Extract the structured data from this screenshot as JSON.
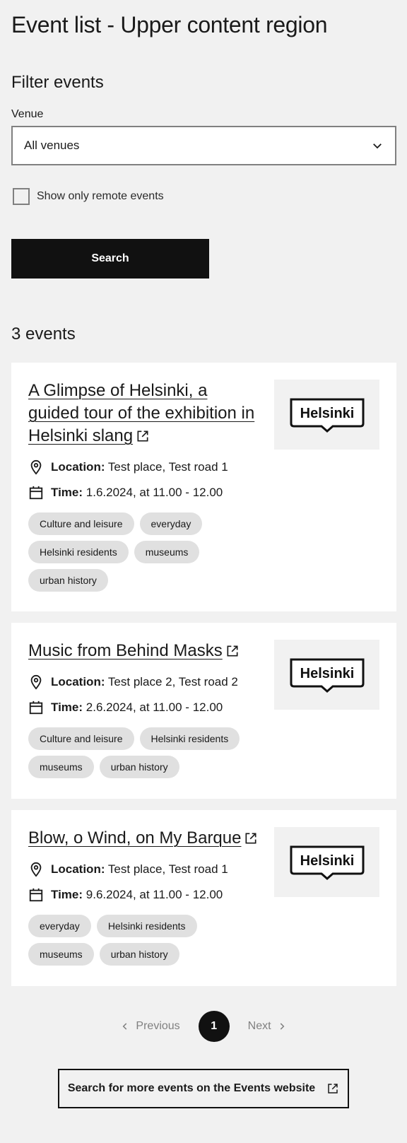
{
  "page": {
    "title": "Event list - Upper content region"
  },
  "filters": {
    "title": "Filter events",
    "venue_label": "Venue",
    "venue_value": "All venues",
    "remote_label": "Show only remote events",
    "search_label": "Search"
  },
  "results": {
    "count_label": "3 events"
  },
  "events": [
    {
      "title": "A Glimpse of Helsinki, a guided tour of the exhibition in Helsinki slang",
      "location_label": "Location:",
      "location": "Test place, Test road 1",
      "time_label": "Time:",
      "time": "1.6.2024, at 11.00 - 12.00",
      "image_text": "Helsinki",
      "tags": [
        "Culture and leisure",
        "everyday",
        "Helsinki residents",
        "museums",
        "urban history"
      ]
    },
    {
      "title": "Music from Behind Masks",
      "location_label": "Location:",
      "location": "Test place 2, Test road 2",
      "time_label": "Time:",
      "time": "2.6.2024, at 11.00 - 12.00",
      "image_text": "Helsinki",
      "tags": [
        "Culture and leisure",
        "Helsinki residents",
        "museums",
        "urban history"
      ]
    },
    {
      "title": "Blow, o Wind, on My Barque",
      "location_label": "Location:",
      "location": "Test place, Test road 1",
      "time_label": "Time:",
      "time": "9.6.2024, at 11.00 - 12.00",
      "image_text": "Helsinki",
      "tags": [
        "everyday",
        "Helsinki residents",
        "museums",
        "urban history"
      ]
    }
  ],
  "pagination": {
    "previous": "Previous",
    "current": "1",
    "next": "Next"
  },
  "more": {
    "label": "Search for more events on the Events website"
  },
  "icons": {
    "venue": "chevron-down-icon",
    "location": "location-pin-icon",
    "time": "calendar-icon",
    "external": "external-link-icon"
  },
  "colors": {
    "background": "#f1f1f1",
    "primary": "#111111",
    "tag": "#e0e0e0",
    "muted": "#808080"
  }
}
